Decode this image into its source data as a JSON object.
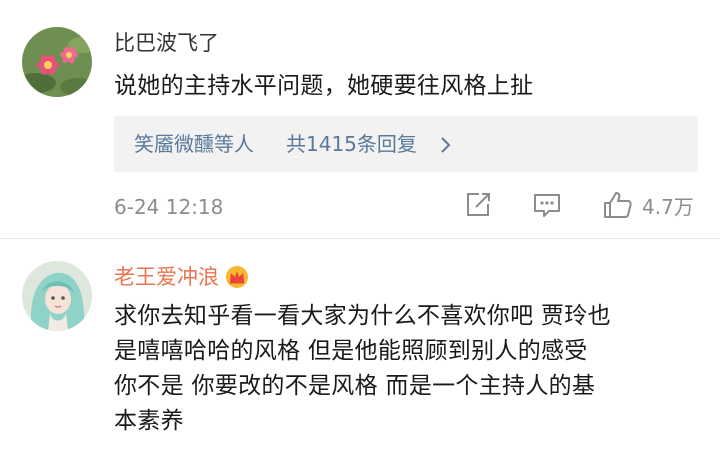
{
  "comments": [
    {
      "username": "比巴波飞了",
      "text": "说她的主持水平问题，她硬要往风格上扯",
      "replies": {
        "users": "笑靥微醺等人",
        "count_text": "共1415条回复"
      },
      "time": "6-24 12:18",
      "likes": "4.7万"
    },
    {
      "username": "老王爱冲浪",
      "text_lines": [
        "求你去知乎看一看大家为什么不喜欢你吧 贾玲也",
        "是嘻嘻哈哈的风格 但是他能照顾到别人的感受",
        "你不是  你要改的不是风格 而是一个主持人的基",
        "本素养"
      ]
    }
  ],
  "icons": {
    "vip_badge": "crown-badge-icon",
    "reply_arrow": "chevron-right-icon",
    "share": "share-icon",
    "reply": "comment-icon",
    "like": "thumbs-up-icon"
  },
  "colors": {
    "username_highlight": "#eb7350",
    "link": "#5a7a9c",
    "meta": "#8c8c8c"
  }
}
